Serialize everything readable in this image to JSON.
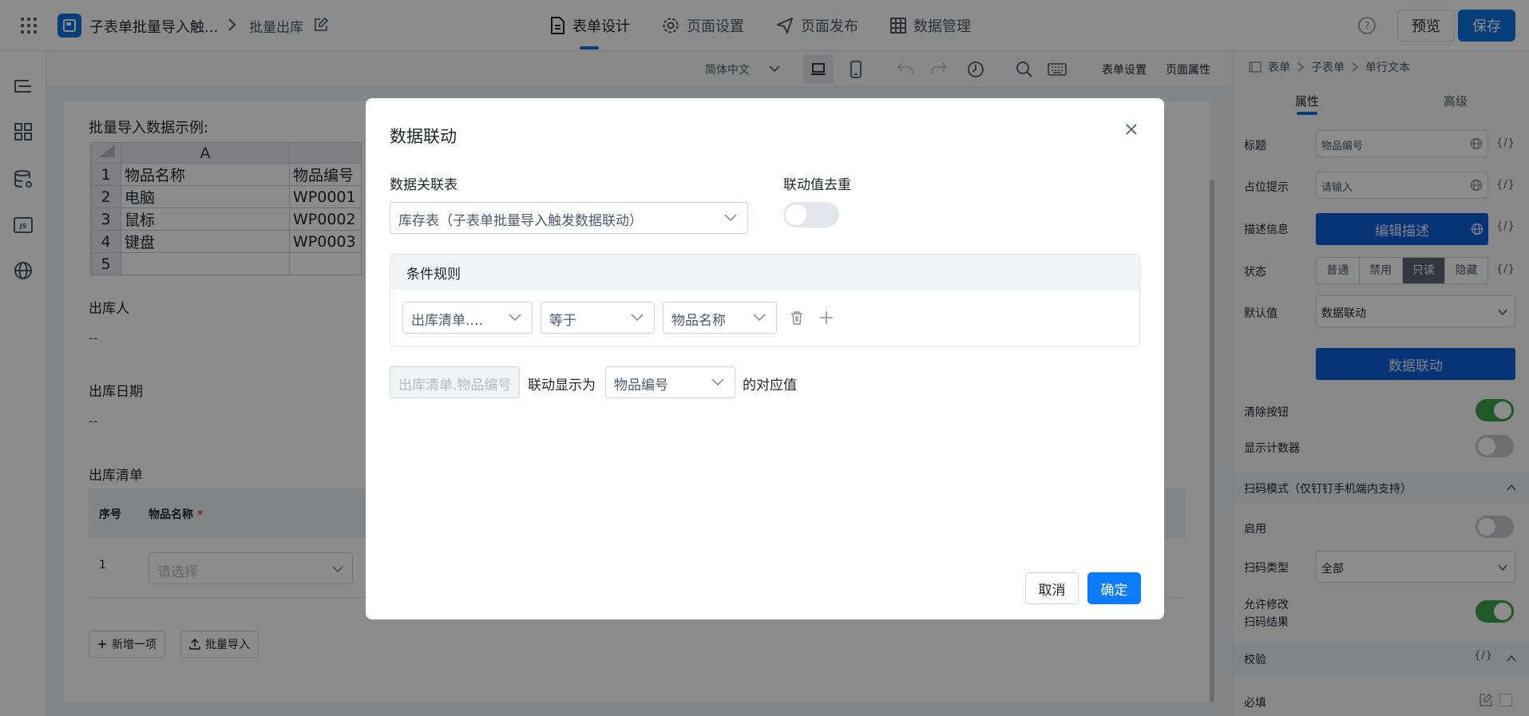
{
  "topbar": {
    "app_title": "子表单批量导入触...",
    "page_name": "批量出库",
    "nav": [
      {
        "label": "表单设计",
        "icon": "document-icon"
      },
      {
        "label": "页面设置",
        "icon": "gear-icon"
      },
      {
        "label": "页面发布",
        "icon": "send-icon"
      },
      {
        "label": "数据管理",
        "icon": "grid-table-icon"
      }
    ],
    "preview_label": "预览",
    "save_label": "保存"
  },
  "toolbar": {
    "language": "简体中文",
    "form_settings": "表单设置",
    "page_properties": "页面属性"
  },
  "canvas": {
    "example_title": "批量导入数据示例:",
    "excel": {
      "col_a": "A",
      "rows": [
        {
          "n": "1",
          "a": "物品名称",
          "b": "物品编号"
        },
        {
          "n": "2",
          "a": "电脑",
          "b": "WP0001"
        },
        {
          "n": "3",
          "a": "鼠标",
          "b": "WP0002"
        },
        {
          "n": "4",
          "a": "键盘",
          "b": "WP0003"
        },
        {
          "n": "5",
          "a": "",
          "b": ""
        }
      ]
    },
    "out_person_label": "出库人",
    "out_person_value": "--",
    "out_date_label": "出库日期",
    "out_date_value": "--",
    "out_list_label": "出库清单",
    "subtable": {
      "col_index": "序号",
      "col_item": "物品名称",
      "required_mark": "*",
      "row_index": "1",
      "select_placeholder": "请选择"
    },
    "add_item_label": "新增一项",
    "batch_import_label": "批量导入"
  },
  "right_panel": {
    "breadcrumb": [
      "表单",
      "子表单",
      "单行文本"
    ],
    "tabs": [
      "属性",
      "高级"
    ],
    "title_label": "标题",
    "title_value": "物品编号",
    "placeholder_label": "占位提示",
    "placeholder_value": "请输入",
    "desc_label": "描述信息",
    "desc_button": "编辑描述",
    "code_glyph": "{/}",
    "state_label": "状态",
    "states": [
      "普通",
      "禁用",
      "只读",
      "隐藏"
    ],
    "state_selected": "只读",
    "default_label": "默认值",
    "default_value": "数据联动",
    "data_link_button": "数据联动",
    "clear_btn_label": "清除按钮",
    "clear_btn_on": true,
    "counter_label": "显示计数器",
    "counter_on": false,
    "scan_section": "扫码模式（仅钉钉手机端内支持）",
    "enable_label": "启用",
    "enable_on": false,
    "scan_type_label": "扫码类型",
    "scan_type_value": "全部",
    "allow_edit_label_1": "允许修改",
    "allow_edit_label_2": "扫码结果",
    "allow_edit_on": true,
    "validate_section": "校验",
    "required_label": "必填"
  },
  "modal": {
    "title": "数据联动",
    "assoc_table_label": "数据关联表",
    "assoc_table_value": "库存表（子表单批量导入触发数据联动）",
    "dedupe_label": "联动值去重",
    "dedupe_on": false,
    "condition_title": "条件规则",
    "condition": {
      "field": "出库清单.…",
      "operator": "等于",
      "target": "物品名称"
    },
    "display_field": "出库清单.物品编号",
    "display_as_text": "联动显示为",
    "display_target": "物品编号",
    "suffix_text": "的对应值",
    "cancel_label": "取消",
    "ok_label": "确定"
  }
}
